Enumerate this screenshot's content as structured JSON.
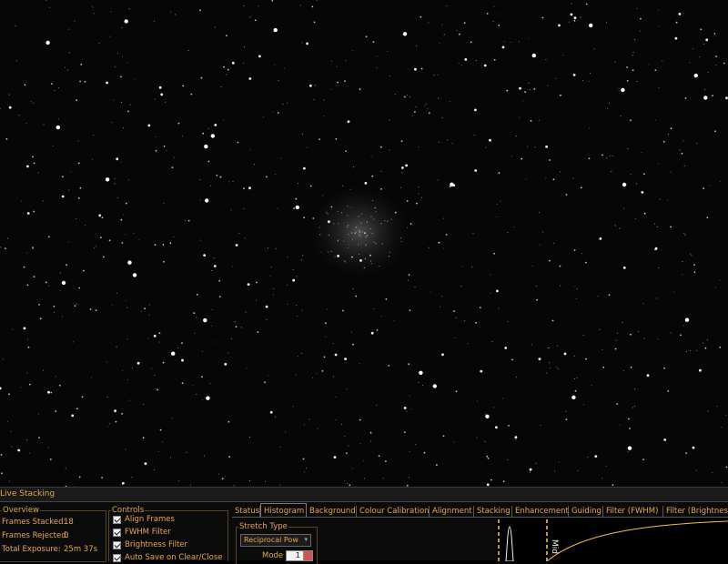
{
  "panel": {
    "title": "Live Stacking"
  },
  "overview": {
    "title": "Overview",
    "rows": [
      {
        "label": "Frames Stacked:",
        "value": "18"
      },
      {
        "label": "Frames Rejected:",
        "value": "0"
      },
      {
        "label": "Total Exposure:",
        "value": "25m 37s"
      }
    ]
  },
  "controls": {
    "title": "Controls",
    "items": [
      {
        "label": "Align Frames",
        "checked": true
      },
      {
        "label": "FWHM Filter",
        "checked": true
      },
      {
        "label": "Brightness Filter",
        "checked": true
      },
      {
        "label": "Auto Save on Clear/Close",
        "checked": true
      }
    ]
  },
  "tabs": [
    {
      "label": "Status",
      "active": false
    },
    {
      "label": "Histogram",
      "active": true
    },
    {
      "label": "Background",
      "active": false
    },
    {
      "label": "Colour Calibration",
      "active": false
    },
    {
      "label": "Alignment",
      "active": false
    },
    {
      "label": "Stacking",
      "active": false
    },
    {
      "label": "Enhancement",
      "active": false
    },
    {
      "label": "Guiding",
      "active": false
    },
    {
      "label": "Filter (FWHM)",
      "active": false
    },
    {
      "label": "Filter (Brightness)",
      "active": false
    }
  ],
  "histogram": {
    "stretch_group_title": "Stretch Type",
    "stretch_type": "Reciprocal Pow",
    "mode_label": "Mode",
    "mode_value": "1",
    "marker_label": "Mid"
  },
  "colors": {
    "accent": "#e3a64e",
    "marker": "#ffd21e",
    "curve": "#f0c040"
  }
}
